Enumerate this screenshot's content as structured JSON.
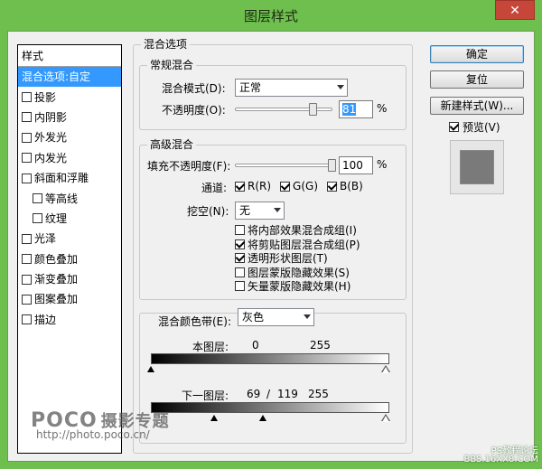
{
  "window": {
    "title": "图层样式",
    "close_label": "✕"
  },
  "style_list": {
    "header": "样式",
    "items": [
      {
        "label": "混合选项:自定",
        "checkbox": false,
        "checked": false,
        "selected": true,
        "sub": false
      },
      {
        "label": "投影",
        "checkbox": true,
        "checked": false,
        "selected": false,
        "sub": false
      },
      {
        "label": "内阴影",
        "checkbox": true,
        "checked": false,
        "selected": false,
        "sub": false
      },
      {
        "label": "外发光",
        "checkbox": true,
        "checked": false,
        "selected": false,
        "sub": false
      },
      {
        "label": "内发光",
        "checkbox": true,
        "checked": false,
        "selected": false,
        "sub": false
      },
      {
        "label": "斜面和浮雕",
        "checkbox": true,
        "checked": false,
        "selected": false,
        "sub": false
      },
      {
        "label": "等高线",
        "checkbox": true,
        "checked": false,
        "selected": false,
        "sub": true
      },
      {
        "label": "纹理",
        "checkbox": true,
        "checked": false,
        "selected": false,
        "sub": true
      },
      {
        "label": "光泽",
        "checkbox": true,
        "checked": false,
        "selected": false,
        "sub": false
      },
      {
        "label": "颜色叠加",
        "checkbox": true,
        "checked": false,
        "selected": false,
        "sub": false
      },
      {
        "label": "渐变叠加",
        "checkbox": true,
        "checked": false,
        "selected": false,
        "sub": false
      },
      {
        "label": "图案叠加",
        "checkbox": true,
        "checked": false,
        "selected": false,
        "sub": false
      },
      {
        "label": "描边",
        "checkbox": true,
        "checked": false,
        "selected": false,
        "sub": false
      }
    ]
  },
  "blend_options": {
    "group_title": "混合选项",
    "general": {
      "title": "常规混合",
      "mode_label": "混合模式(D):",
      "mode_value": "正常",
      "opacity_label": "不透明度(O):",
      "opacity_value": "81",
      "opacity_fraction": 0.81,
      "percent": "%"
    },
    "advanced": {
      "title": "高级混合",
      "fill_label": "填充不透明度(F):",
      "fill_value": "100",
      "fill_fraction": 1.0,
      "percent": "%",
      "channels_label": "通道:",
      "channels": [
        {
          "label": "R(R)",
          "checked": true
        },
        {
          "label": "G(G)",
          "checked": true
        },
        {
          "label": "B(B)",
          "checked": true
        }
      ],
      "knockout_label": "挖空(N):",
      "knockout_value": "无",
      "options": [
        {
          "label": "将内部效果混合成组(I)",
          "checked": false
        },
        {
          "label": "将剪贴图层混合成组(P)",
          "checked": true
        },
        {
          "label": "透明形状图层(T)",
          "checked": true
        },
        {
          "label": "图层蒙版隐藏效果(S)",
          "checked": false
        },
        {
          "label": "矢量蒙版隐藏效果(H)",
          "checked": false
        }
      ]
    },
    "blend_if": {
      "label": "混合颜色带(E):",
      "value": "灰色",
      "this_layer_label": "本图层:",
      "this_layer_low": "0",
      "this_layer_high": "255",
      "underlying_label": "下一图层:",
      "underlying_low": "69",
      "underlying_sep": "/",
      "underlying_mid": "119",
      "underlying_high": "255"
    }
  },
  "buttons": {
    "ok": "确定",
    "reset": "复位",
    "new_style": "新建样式(W)...",
    "preview_label": "预览(V)",
    "preview_checked": true
  },
  "watermarks": {
    "logo": "POCO",
    "logo_sub": "摄影专题",
    "url": "http://photo.poco.cn/",
    "br1": "PS教程论坛",
    "br2": "BBS.16XX8.COM"
  }
}
